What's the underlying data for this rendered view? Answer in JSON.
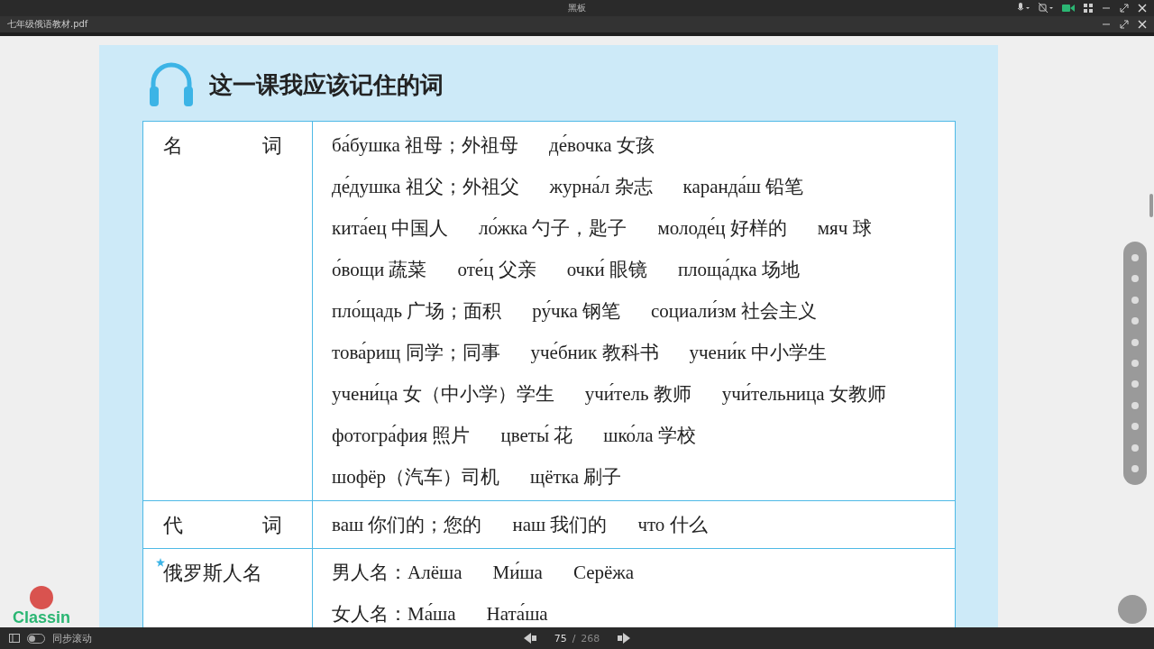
{
  "window": {
    "title": "黑板"
  },
  "document_tab": {
    "filename": "七年级俄语教材.pdf"
  },
  "page": {
    "heading": "这一课我应该记住的词",
    "rows": [
      {
        "category": "名　　　　词",
        "starred": false,
        "lines": [
          [
            "ба́бушка 祖母；外祖母",
            "де́вочка 女孩"
          ],
          [
            "де́душка 祖父；外祖父",
            "журна́л 杂志",
            "каранда́ш 铅笔"
          ],
          [
            "кита́ец 中国人",
            "ло́жка 勺子，匙子",
            "молоде́ц 好样的",
            "мяч 球"
          ],
          [
            "о́вощи 蔬菜",
            "оте́ц 父亲",
            "очки́ 眼镜",
            "площа́дка 场地"
          ],
          [
            "пло́щадь 广场；面积",
            "ру́чка 钢笔",
            "социали́зм 社会主义"
          ],
          [
            "това́рищ 同学；同事",
            "уче́бник 教科书",
            "учени́к 中小学生"
          ],
          [
            "учени́ца 女（中小学）学生",
            "учи́тель 教师",
            "учи́тельница 女教师"
          ],
          [
            "фотогра́фия 照片",
            "цветы́ 花",
            "шко́ла 学校"
          ],
          [
            "шофёр（汽车）司机",
            "щётка 刷子"
          ]
        ]
      },
      {
        "category": "代　　　　词",
        "starred": false,
        "lines": [
          [
            "ваш 你们的；您的",
            "наш 我们的",
            "что 什么"
          ]
        ]
      },
      {
        "category": "俄罗斯人名",
        "starred": true,
        "lines": [
          [
            "男人名：Алёша",
            "Ми́ша",
            "Серёжа"
          ],
          [
            "女人名：Ма́ша",
            "Ната́ша"
          ]
        ]
      }
    ]
  },
  "logo": {
    "text": "Classin"
  },
  "bottom_bar": {
    "sync_scroll": {
      "label": "同步滚动",
      "on": false
    },
    "page_current": "75",
    "page_separator": "/",
    "page_total": "268"
  }
}
